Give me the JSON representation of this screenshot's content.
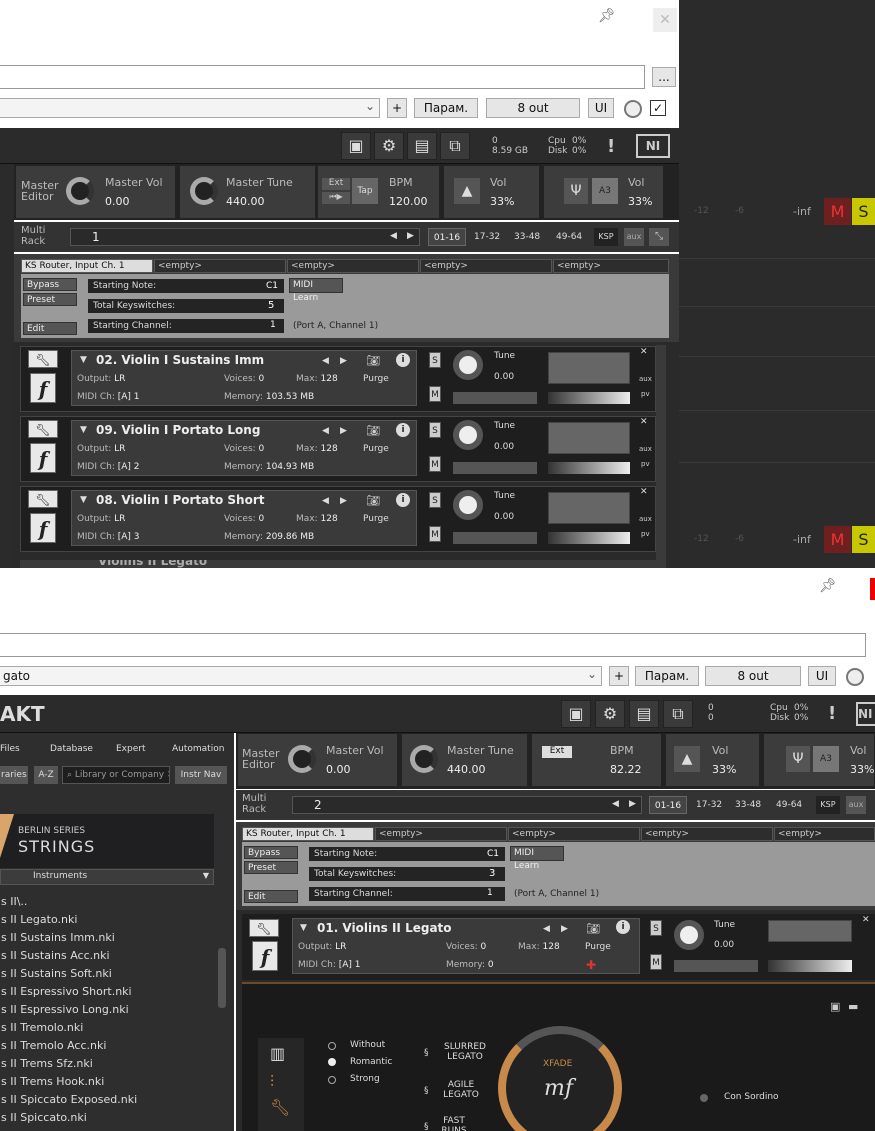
{
  "top_window": {
    "params_label": "Парам.",
    "out_label": "8 out",
    "ui_label": "UI",
    "plus_label": "+",
    "dots_label": "...",
    "ram": "0",
    "ram2": "8.59 GB",
    "cpu_label": "Cpu",
    "cpu_value": "0%",
    "disk_label": "Disk",
    "disk_value": "0%",
    "master_editor": "Master Editor",
    "master_vol_label": "Master Vol",
    "master_vol_value": "0.00",
    "master_tune_label": "Master Tune",
    "master_tune_value": "440.00",
    "ext_label": "Ext",
    "tap_label": "Tap",
    "bpm_label": "BPM",
    "bpm_value": "120.00",
    "vol_label": "Vol",
    "vol_value": "33%",
    "a3_label": "A3",
    "vol2_label": "Vol",
    "vol2_value": "33%",
    "multi_rack_label": "Multi Rack",
    "rack_number": "1",
    "rack_tabs": [
      "01-16",
      "17-32",
      "33-48",
      "49-64",
      "KSP"
    ],
    "aux_label": "aux",
    "script_tabs": [
      "KS Router, Input Ch. 1",
      "<empty>",
      "<empty>",
      "<empty>",
      "<empty>"
    ],
    "bypass": "Bypass",
    "preset": "Preset",
    "edit": "Edit",
    "starting_note_label": "Starting Note:",
    "starting_note_value": "C1",
    "midi_learn": "MIDI Learn",
    "total_ks_label": "Total Keyswitches:",
    "total_ks_value": "5",
    "starting_channel_label": "Starting Channel:",
    "starting_channel_value": "1",
    "port_text": "(Port A, Channel 1)",
    "instruments": [
      {
        "name": "02. Violin I Sustains Imm",
        "output": "LR",
        "voices": "0",
        "max": "128",
        "midi": "[A] 1",
        "memory": "103.53 MB",
        "tune": "0.00"
      },
      {
        "name": "09. Violin I Portato Long",
        "output": "LR",
        "voices": "0",
        "max": "128",
        "midi": "[A] 2",
        "memory": "104.93 MB",
        "tune": "0.00"
      },
      {
        "name": "08. Violin I Portato Short",
        "output": "LR",
        "voices": "0",
        "max": "128",
        "midi": "[A] 3",
        "memory": "209.86 MB",
        "tune": "0.00"
      }
    ],
    "partial_name": "Violins II Legato",
    "labels": {
      "output": "Output:",
      "voices": "Voices:",
      "max": "Max:",
      "midi": "MIDI Ch:",
      "memory": "Memory:",
      "purge": "Purge",
      "tune": "Tune",
      "aux": "aux",
      "pv": "pv"
    },
    "track_inf": "-inf",
    "track_scale": [
      "-12",
      "-6"
    ],
    "mute": "M",
    "solo": "S"
  },
  "bottom_window": {
    "preset_value": "gato",
    "params_label": "Парам.",
    "out_label": "8 out",
    "ui_label": "UI",
    "plus_label": "+",
    "app_title": "AKT",
    "ram": "0",
    "ram2": "0",
    "cpu_label": "Cpu",
    "cpu_value": "0%",
    "disk_label": "Disk",
    "disk_value": "0%",
    "browser_tabs": [
      "Files",
      "Database",
      "Expert",
      "Automation"
    ],
    "browser_tabs2": [
      "raries",
      "A-Z"
    ],
    "search_placeholder": "Library or Company",
    "instr_nav": "Instr Nav",
    "library_series": "BERLIN SERIES",
    "library_name": "STRINGS",
    "instruments_dropdown": "Instruments",
    "files": [
      "s II\\..",
      "s II Legato.nki",
      "s II Sustains Imm.nki",
      "s II Sustains Acc.nki",
      "s II Sustains Soft.nki",
      "s II Espressivo Short.nki",
      "s II Espressivo Long.nki",
      "s II Tremolo.nki",
      "s II Tremolo Acc.nki",
      "s II Trems Sfz.nki",
      "s II Trems Hook.nki",
      "s II Spiccato Exposed.nki",
      "s II Spiccato.nki"
    ],
    "master_editor": "Master Editor",
    "master_vol_label": "Master Vol",
    "master_vol_value": "0.00",
    "master_tune_label": "Master Tune",
    "master_tune_value": "440.00",
    "ext_label": "Ext",
    "bpm_label": "BPM",
    "bpm_value": "82.22",
    "vol_label": "Vol",
    "vol_value": "33%",
    "a3_label": "A3",
    "vol2_label": "Vol",
    "vol2_value": "33%",
    "multi_rack_label": "Multi Rack",
    "rack_number": "2",
    "rack_tabs": [
      "01-16",
      "17-32",
      "33-48",
      "49-64",
      "KSP"
    ],
    "aux_label": "aux",
    "script_tabs": [
      "KS Router, Input Ch. 1",
      "<empty>",
      "<empty>",
      "<empty>",
      "<empty>"
    ],
    "bypass": "Bypass",
    "preset": "Preset",
    "edit": "Edit",
    "starting_note_label": "Starting Note:",
    "starting_note_value": "C1",
    "midi_learn": "MIDI Learn",
    "total_ks_label": "Total Keyswitches:",
    "total_ks_value": "3",
    "starting_channel_label": "Starting Channel:",
    "starting_channel_value": "1",
    "port_text": "(Port A, Channel 1)",
    "instrument": {
      "name": "01. Violins II Legato",
      "output": "LR",
      "voices": "0",
      "max": "128",
      "midi": "[A] 1",
      "memory": "0",
      "tune": "0.00"
    },
    "labels": {
      "output": "Output:",
      "voices": "Voices:",
      "max": "Max:",
      "midi": "MIDI Ch:",
      "memory": "Memory:",
      "purge": "Purge",
      "tune": "Tune"
    },
    "vibrato_options": [
      "Without",
      "Romantic",
      "Strong"
    ],
    "articulations": [
      "SLURRED LEGATO",
      "AGILE LEGATO",
      "FAST RUNS"
    ],
    "xfade_label": "XFADE",
    "dynamic_label": "mf",
    "con_sordino": "Con Sordino"
  }
}
